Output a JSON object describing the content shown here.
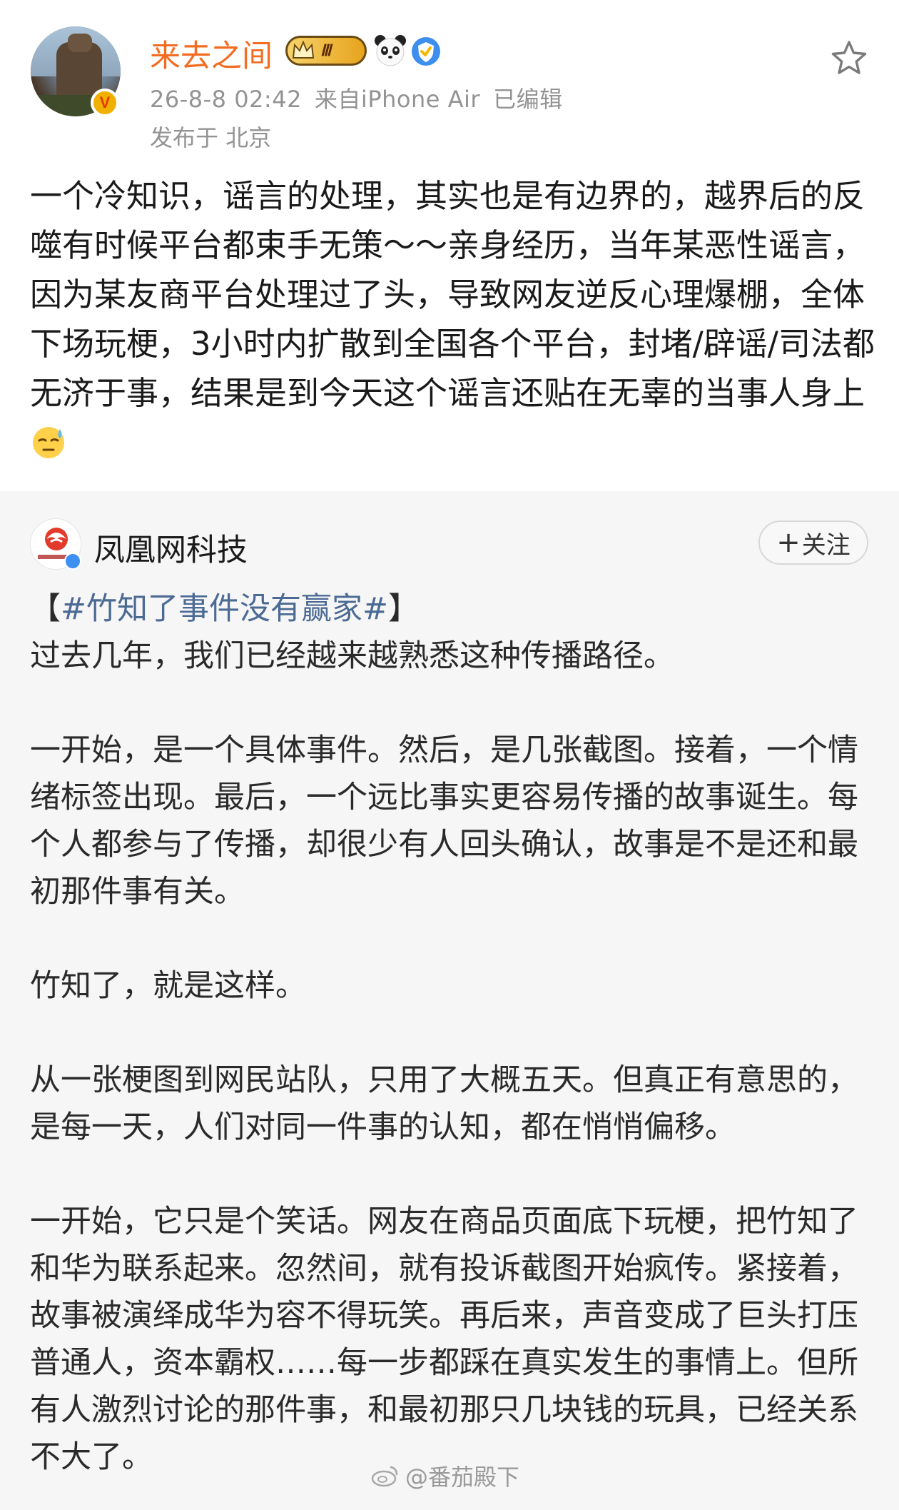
{
  "post": {
    "username": "来去之间",
    "membership_badge": "Ⅲ",
    "timestamp": "26-8-8 02:42",
    "source": "来自iPhone Air",
    "edited": "已编辑",
    "location": "发布于 北京",
    "text": "一个冷知识，谣言的处理，其实也是有边界的，越界后的反噬有时候平台都束手无策～～亲身经历，当年某恶性谣言，因为某友商平台处理过了头，导致网友逆反心理爆棚，全体下场玩梗，3小时内扩散到全国各个平台，封堵/辟谣/司法都无济于事，结果是到今天这个谣言还贴在无辜的当事人身上",
    "emoji": "sweat-emoji",
    "accent_color": "#f36c21"
  },
  "repost": {
    "source_name": "凤凰网科技",
    "follow_label": "关注",
    "hashtag_open": "【",
    "hashtag": "#竹知了事件没有赢家#",
    "hashtag_close": "】",
    "body": "过去几年，我们已经越来越熟悉这种传播路径。\n\n一开始，是一个具体事件。然后，是几张截图。接着，一个情绪标签出现。最后，一个远比事实更容易传播的故事诞生。每个人都参与了传播，却很少有人回头确认，故事是不是还和最初那件事有关。\n\n竹知了，就是这样。\n\n从一张梗图到网民站队，只用了大概五天。但真正有意思的，是每一天，人们对同一件事的认知，都在悄悄偏移。\n\n一开始，它只是个笑话。网友在商品页面底下玩梗，把竹知了和华为联系起来。忽然间，就有投诉截图开始疯传。紧接着，故事被演绎成华为容不得玩笑。再后来，声音变成了巨头打压普通人，资本霸权……每一步都踩在真实发生的事情上。但所有人激烈讨论的那件事，和最初那只几块钱的玩具，已经关系不大了。",
    "hashtag_color": "#4b6a94",
    "background": "#f6f6f6"
  },
  "watermark": "@番茄殿下"
}
